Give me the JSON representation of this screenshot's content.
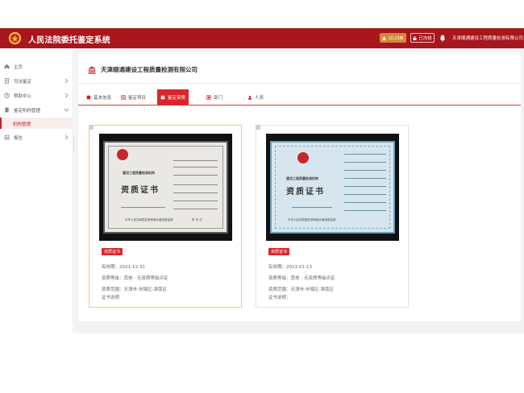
{
  "header": {
    "app_title": "人民法院委托鉴定系统",
    "alert_label": "10,23条",
    "freeze_label": "已冻结",
    "org_name": "天津顺通建设工程质量检测有限公司"
  },
  "sidebar": {
    "items": [
      {
        "label": "主页"
      },
      {
        "label": "司法鉴定"
      },
      {
        "label": "帮助中心"
      },
      {
        "label": "鉴定机构管理"
      },
      {
        "label": "报告"
      }
    ],
    "active_sub": "机构管理"
  },
  "company": {
    "name": "天津顺通建设工程质量检测有限公司"
  },
  "tabs": [
    {
      "label": "基本信息"
    },
    {
      "label": "鉴定项目"
    },
    {
      "label": "鉴定资质"
    },
    {
      "label": "部门"
    },
    {
      "label": "人员"
    }
  ],
  "active_tab": "鉴定资质",
  "cards": [
    {
      "badge": "资质证书",
      "valid_label": "有效期：",
      "valid_value": "2021-12-31",
      "level_label": "资质等级：",
      "level_value": "其他 - 无资质等级评定",
      "scope_label": "资质范围：",
      "scope_value": "天津市-市辖区-津南区",
      "note_label": "证书说明",
      "note_value": "",
      "cert": {
        "heading": "资质证书",
        "org": "建设工程质量检测机构",
        "footer": "中华人民共和国住房和城乡建设部监制",
        "date": "年 月 日"
      }
    },
    {
      "badge": "资质证书",
      "valid_label": "有效期：",
      "valid_value": "2023-01-13",
      "level_label": "资质等级：",
      "level_value": "其他 - 无资质等级评定",
      "scope_label": "资质范围：",
      "scope_value": "天津市-市辖区-津南区",
      "note_label": "证书说明：",
      "note_value": "",
      "cert": {
        "heading": "资质证书",
        "org": "建设工程质量检测机构",
        "footer": "中华人民共和国住房和城乡建设部监制",
        "date": ""
      }
    }
  ],
  "colors": {
    "brand": "#a8171b",
    "accent": "#d9252a",
    "selected_border": "#f0c58a"
  }
}
